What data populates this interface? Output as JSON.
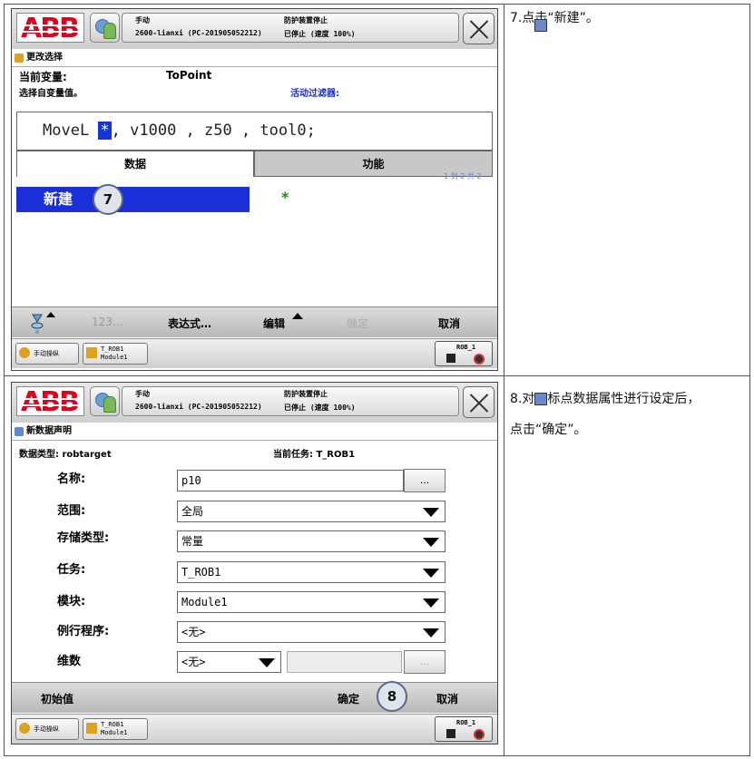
{
  "step7": {
    "note": "7.点击“新建”。",
    "header": {
      "mode": "手动",
      "controller": "2600-lianxi (PC-201905052212)",
      "safety": "防护装置停止",
      "state": "已停止 (速度 100%)"
    },
    "subtitle": "更改选择",
    "current_var_label": "当前变量:",
    "current_var_value": "ToPoint",
    "select_label": "选择自变量值。",
    "filter_label": "活动过滤器:",
    "code_prefix": "MoveL ",
    "code_highlight": "*",
    "code_suffix": ", v1000 , z50 , tool0;",
    "tabs": [
      "数据",
      "功能"
    ],
    "page_info": "1 到 2 共 2",
    "list_items": [
      "新建",
      "*"
    ],
    "marker": "7",
    "bottom_buttons": [
      "123...",
      "表达式…",
      "编辑",
      "确定",
      "取消"
    ],
    "taskbar": {
      "jog": "手动操纵",
      "prog_line1": "T_ROB1",
      "prog_line2": "Module1",
      "rob": "ROB_1"
    }
  },
  "step8": {
    "note_line1": "8.对目标点数据属性进行设定后，",
    "note_line2": "点击“确定”。",
    "header": {
      "mode": "手动",
      "controller": "2600-lianxi (PC-201905052212)",
      "safety": "防护装置停止",
      "state": "已停止 (速度 100%)"
    },
    "subtitle": "新数据声明",
    "data_type_label": "数据类型: robtarget",
    "task_label": "当前任务:  T_ROB1",
    "fields": [
      {
        "label": "名称:",
        "value": "p10"
      },
      {
        "label": "范围:",
        "value": "全局"
      },
      {
        "label": "存储类型:",
        "value": "常量"
      },
      {
        "label": "任务:",
        "value": "T_ROB1"
      },
      {
        "label": "模块:",
        "value": "Module1"
      },
      {
        "label": "例行程序:",
        "value": "<无>"
      },
      {
        "label": "维数",
        "value": "<无>"
      }
    ],
    "dots": "...",
    "marker": "8",
    "bottom_buttons": [
      "初始值",
      "确定",
      "取消"
    ],
    "taskbar": {
      "jog": "手动操纵",
      "prog_line1": "T_ROB1",
      "prog_line2": "Module1",
      "rob": "ROB_1"
    }
  },
  "colors": {
    "selection": "#1a2fd8",
    "abb_red": "#e2001a",
    "marker_fill": "#dfe3ea"
  }
}
